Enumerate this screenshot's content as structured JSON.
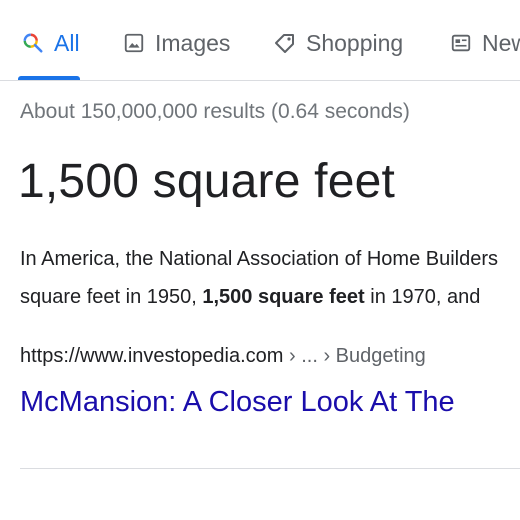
{
  "tabs": [
    {
      "label": "All",
      "icon": "search-icon",
      "active": true
    },
    {
      "label": "Images",
      "icon": "image-icon",
      "active": false
    },
    {
      "label": "Shopping",
      "icon": "tag-icon",
      "active": false
    },
    {
      "label": "News",
      "icon": "news-icon",
      "active": false
    }
  ],
  "colors": {
    "active_tab": "#1a73e8",
    "link": "#1a0dab",
    "stats": "#70757a"
  },
  "stats": "About 150,000,000 results (0.64 seconds)",
  "answer": "1,500 square feet",
  "snippet": {
    "line1": "In America, the National Association of Home Builders",
    "line2_pre": "square feet in 1950, ",
    "line2_bold": "1,500 square feet",
    "line2_post": " in 1970, and"
  },
  "result": {
    "url": "https://www.investopedia.com",
    "breadcrumb": " › ... › Budgeting",
    "title": "McMansion: A Closer Look At The"
  }
}
